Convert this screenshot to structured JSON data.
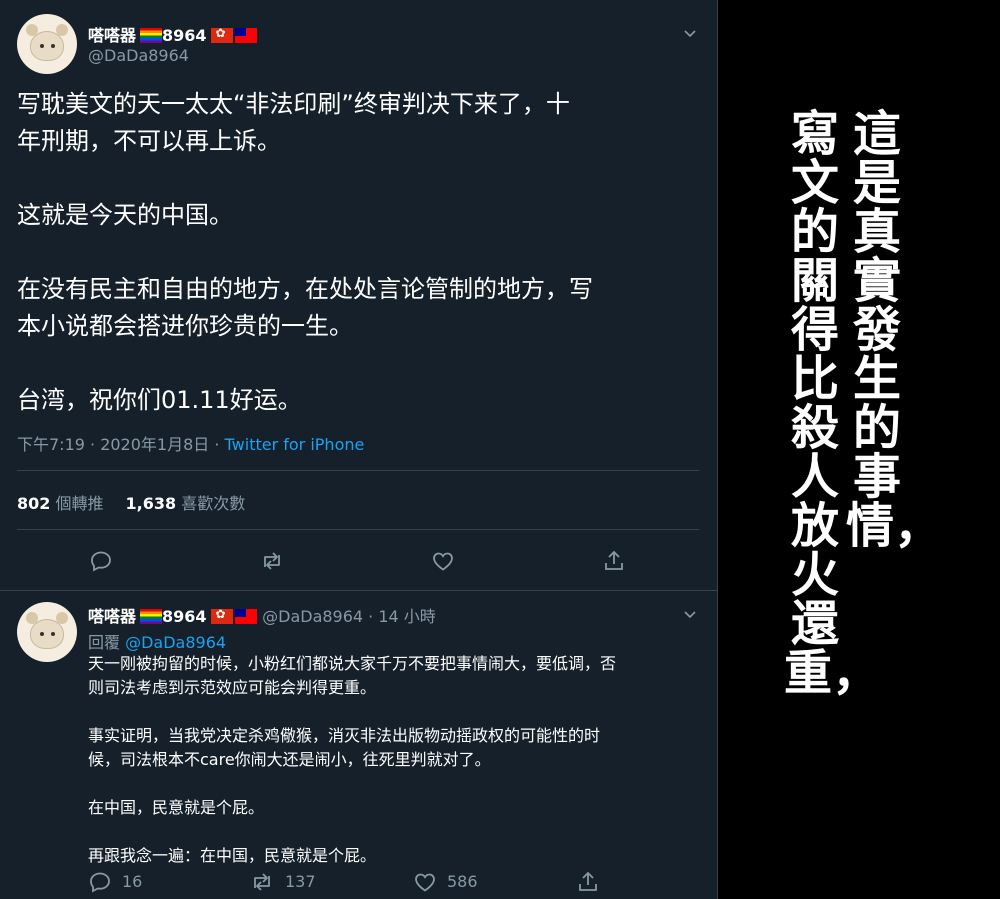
{
  "tweet": {
    "display_name": "嗒嗒器",
    "name_number": "8964",
    "handle": "@DaDa8964",
    "text": "写耽美文的天一太太“非法印刷”终审判决下来了，十\n年刑期，不可以再上诉。\n\n这就是今天的中国。\n\n在没有民主和自由的地方，在处处言论管制的地方，写\n本小说都会搭进你珍贵的一生。\n\n台湾，祝你们01.11好运。",
    "timestamp": "下午7:19 · 2020年1月8日 · ",
    "source": "Twitter for iPhone",
    "retweet_count": "802",
    "retweet_label": "個轉推",
    "like_count": "1,638",
    "like_label": "喜歡次數",
    "icons": [
      "reply-icon",
      "retweet-icon",
      "like-icon",
      "share-icon"
    ]
  },
  "reply": {
    "display_name": "嗒嗒器",
    "name_number": "8964",
    "handle": "@DaDa8964",
    "time": " · 14 小時",
    "reply_label": "回覆 ",
    "reply_to": "@DaDa8964",
    "text": "天一刚被拘留的时候，小粉红们都说大家千万不要把事情闹大，要低调，否\n则司法考虑到示范效应可能会判得更重。\n\n事实证明，当我党决定杀鸡儆猴，消灭非法出版物动摇政权的可能性的时\n候，司法根本不care你闹大还是闹小，往死里判就对了。\n\n在中国，民意就是个屁。\n\n再跟我念一遍：在中国，民意就是个屁。",
    "reply_count": "16",
    "retweet_count": "137",
    "like_count": "586"
  },
  "caption": {
    "column_right": "這是真實發生的事情，",
    "column_left": "寫文的關得比殺人放火還重，"
  },
  "colors": {
    "background": "#15202b",
    "text": "#ffffff",
    "muted": "#8899a6",
    "accent": "#1da1f2",
    "divider": "#38444d",
    "side": "#000000"
  }
}
